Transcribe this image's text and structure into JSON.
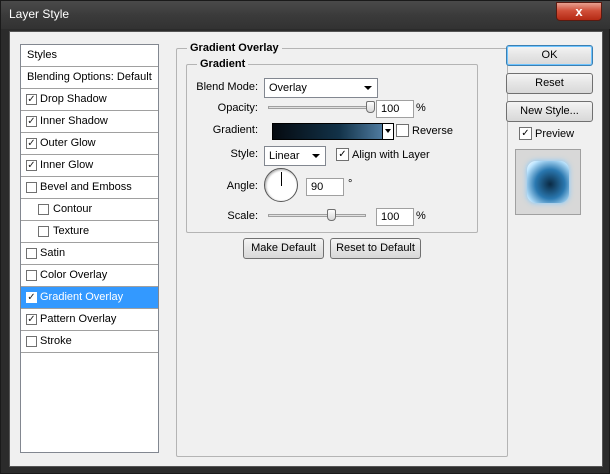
{
  "window": {
    "title": "Layer Style",
    "close_label": "x"
  },
  "sidebar": {
    "styles_label": "Styles",
    "blending_label": "Blending Options: Default",
    "items": [
      {
        "label": "Drop Shadow",
        "checked": true,
        "indent": false
      },
      {
        "label": "Inner Shadow",
        "checked": true,
        "indent": false
      },
      {
        "label": "Outer Glow",
        "checked": true,
        "indent": false
      },
      {
        "label": "Inner Glow",
        "checked": true,
        "indent": false
      },
      {
        "label": "Bevel and Emboss",
        "checked": false,
        "indent": false
      },
      {
        "label": "Contour",
        "checked": false,
        "indent": true
      },
      {
        "label": "Texture",
        "checked": false,
        "indent": true
      },
      {
        "label": "Satin",
        "checked": false,
        "indent": false
      },
      {
        "label": "Color Overlay",
        "checked": false,
        "indent": false
      },
      {
        "label": "Gradient Overlay",
        "checked": true,
        "indent": false,
        "selected": true
      },
      {
        "label": "Pattern Overlay",
        "checked": true,
        "indent": false
      },
      {
        "label": "Stroke",
        "checked": false,
        "indent": false
      }
    ]
  },
  "panel": {
    "group_title": "Gradient Overlay",
    "subgroup_title": "Gradient",
    "blend_mode": {
      "label": "Blend Mode:",
      "value": "Overlay"
    },
    "opacity": {
      "label": "Opacity:",
      "value": "100",
      "unit": "%",
      "level": 1.0
    },
    "gradient": {
      "label": "Gradient:",
      "reverse_label": "Reverse",
      "reverse_checked": false
    },
    "style": {
      "label": "Style:",
      "value": "Linear",
      "align_label": "Align with Layer",
      "align_checked": true
    },
    "angle": {
      "label": "Angle:",
      "value": "90",
      "unit": "°"
    },
    "scale": {
      "label": "Scale:",
      "value": "100",
      "unit": "%",
      "level": 0.6
    },
    "make_default": "Make Default",
    "reset_default": "Reset to Default"
  },
  "buttons": {
    "ok": "OK",
    "reset": "Reset",
    "new_style": "New Style...",
    "preview_label": "Preview",
    "preview_checked": true
  },
  "colors": {
    "selection": "#3399ff",
    "gradient_start": "#050a10",
    "gradient_end": "#5e8db5"
  }
}
